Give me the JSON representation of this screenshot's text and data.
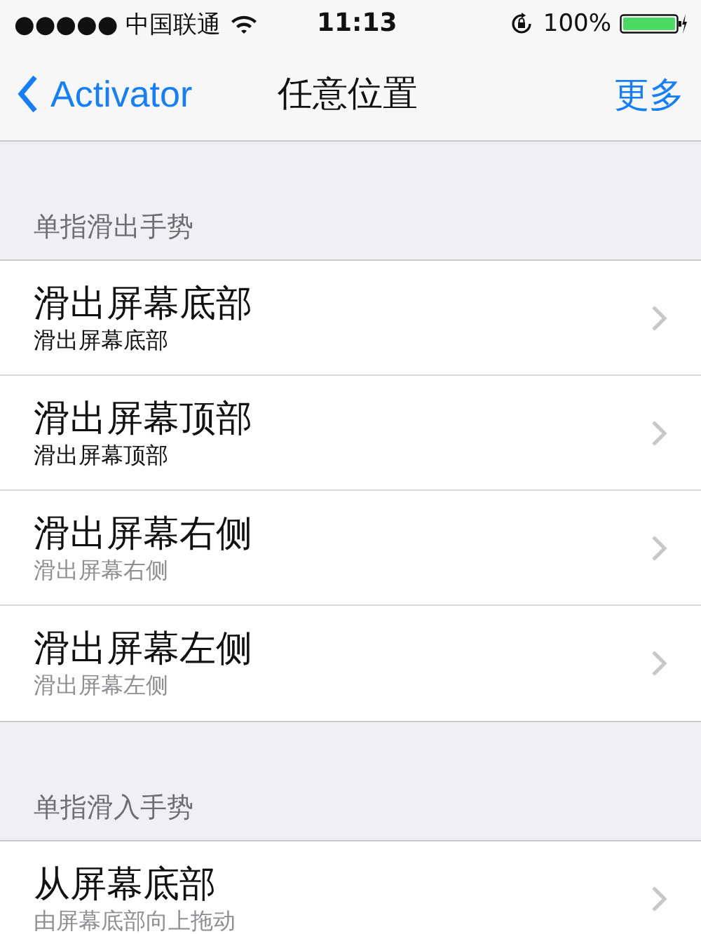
{
  "status_bar": {
    "carrier": "●●●●● 中国联通",
    "time": "11:13",
    "battery": "100%"
  },
  "nav": {
    "back": "Activator",
    "title": "任意位置",
    "action": "更多"
  },
  "sections": [
    {
      "header": "单指滑出手势",
      "rows": [
        {
          "title": "滑出屏幕底部",
          "subtitle": "滑出屏幕底部",
          "active": true
        },
        {
          "title": "滑出屏幕顶部",
          "subtitle": "滑出屏幕顶部",
          "active": true
        },
        {
          "title": "滑出屏幕右侧",
          "subtitle": "滑出屏幕右侧",
          "active": false
        },
        {
          "title": "滑出屏幕左侧",
          "subtitle": "滑出屏幕左侧",
          "active": false
        }
      ]
    },
    {
      "header": "单指滑入手势",
      "rows": [
        {
          "title": "从屏幕底部",
          "subtitle": "由屏幕底部向上拖动",
          "active": false
        }
      ]
    }
  ]
}
